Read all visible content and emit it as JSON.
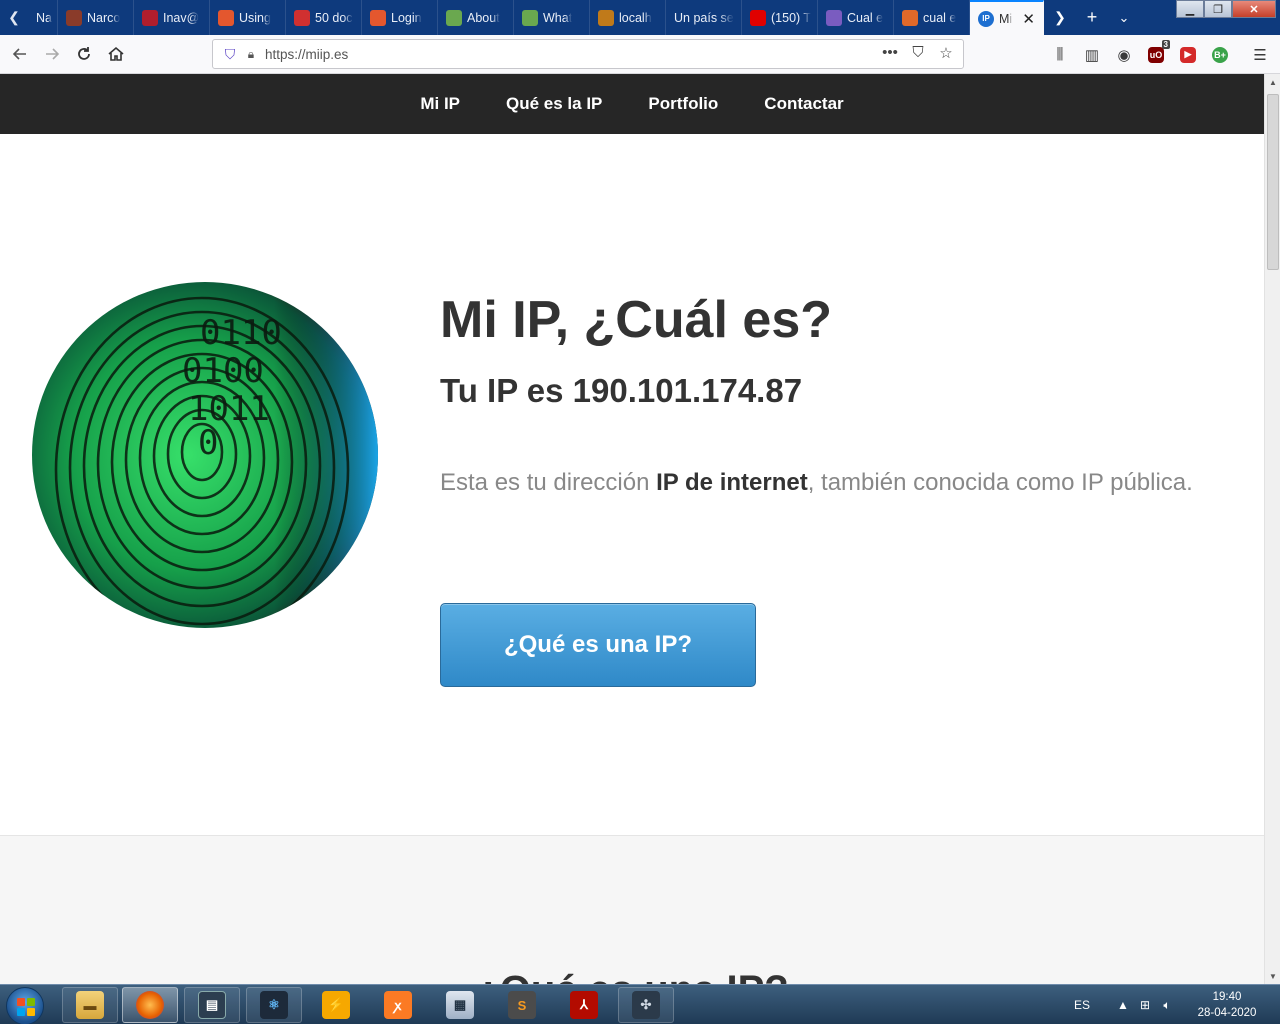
{
  "browser": {
    "tabs": [
      {
        "label": "Na",
        "fav_color": "#555"
      },
      {
        "label": "Narco",
        "fav_color": "#8a3b2a"
      },
      {
        "label": "Inav@",
        "fav_color": "#b01e2d"
      },
      {
        "label": "Using",
        "fav_color": "#e4572e"
      },
      {
        "label": "50 doc",
        "fav_color": "#d03030"
      },
      {
        "label": "Login",
        "fav_color": "#e4572e"
      },
      {
        "label": "About",
        "fav_color": "#6aa84f"
      },
      {
        "label": "What",
        "fav_color": "#6aa84f"
      },
      {
        "label": "localh",
        "fav_color": "#c07a1a"
      },
      {
        "label": "Un país se",
        "fav_color": ""
      },
      {
        "label": "(150) T",
        "fav_color": "#e00000"
      },
      {
        "label": "Cual e",
        "fav_color": "#7a5cc0"
      },
      {
        "label": "cual e",
        "fav_color": "#e0692a"
      }
    ],
    "active_tab": {
      "label": "Mi",
      "fav_text": "IP"
    },
    "url": "https://miip.es"
  },
  "site": {
    "nav": [
      "Mi IP",
      "Qué es la IP",
      "Portfolio",
      "Contactar"
    ],
    "hero": {
      "title_bold": "Mi IP",
      "title_rest": ", ¿Cuál es?",
      "ip_line": "Tu IP es 190.101.174.87",
      "desc_1": "Esta es tu dirección ",
      "desc_bold": "IP de internet",
      "desc_2": ", también conocida como IP pública.",
      "cta": "¿Qué es una IP?"
    },
    "section2_title": "¿Qué es una IP?"
  },
  "taskbar": {
    "lang": "ES",
    "time": "19:40",
    "date": "28-04-2020",
    "extension_badge": "3",
    "extension_label": "uO",
    "extension2_label": "B+"
  },
  "colors": {
    "site_nav": "#262626",
    "cta": "#3a92cf",
    "tabstrip": "#0e3a7d"
  }
}
